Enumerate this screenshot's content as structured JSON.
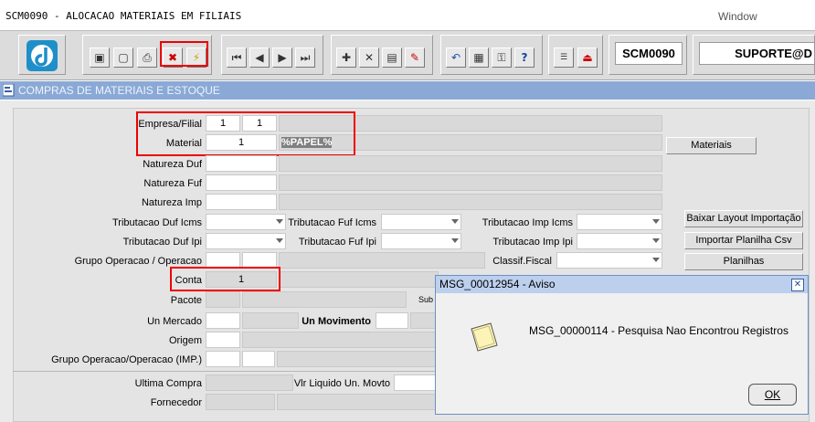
{
  "window": {
    "title": "SCM0090 - ALOCACAO MATERIAIS EM FILIAIS",
    "menu_window": "Window"
  },
  "toolbar": {
    "form_code": "SCM0090",
    "user": "SUPORTE@D"
  },
  "section": {
    "title": "COMPRAS DE MATERIAIS E ESTOQUE"
  },
  "form": {
    "empresa_filial_label": "Empresa/Filial",
    "empresa_value": "1",
    "filial_value": "1",
    "material_label": "Material",
    "material_value": "1",
    "material_desc": "%PAPEL%",
    "natureza_duf_label": "Natureza Duf",
    "natureza_fuf_label": "Natureza Fuf",
    "natureza_imp_label": "Natureza Imp",
    "trib_duf_icms_label": "Tributacao Duf Icms",
    "trib_fuf_icms_label": "Tributacao Fuf Icms",
    "trib_imp_icms_label": "Tributacao Imp Icms",
    "trib_duf_ipi_label": "Tributacao Duf Ipi",
    "trib_fuf_ipi_label": "Tributacao Fuf Ipi",
    "trib_imp_ipi_label": "Tributacao Imp Ipi",
    "grupo_operacao_label": "Grupo Operacao / Operacao",
    "classif_fiscal_label": "Classif.Fiscal",
    "conta_label": "Conta",
    "conta_value": "1",
    "pacote_label": "Pacote",
    "sub_label": "Sub",
    "un_mercado_label": "Un Mercado",
    "un_movimento_label": "Un Movimento",
    "origem_label": "Origem",
    "grupo_operacao_imp_label": "Grupo Operacao/Operacao (IMP.)",
    "ultima_compra_label": "Ultima Compra",
    "vlr_liquido_label": "Vlr Liquido Un. Movto",
    "fornecedor_label": "Fornecedor"
  },
  "buttons": {
    "materiais": "Materiais",
    "baixar_layout": "Baixar Layout Importação",
    "importar_planilha": "Importar Planilha Csv",
    "planilhas": "Planilhas"
  },
  "dialog": {
    "title": "MSG_00012954 - Aviso",
    "message": "MSG_00000114 - Pesquisa Nao Encontrou Registros",
    "ok_label": "OK"
  }
}
